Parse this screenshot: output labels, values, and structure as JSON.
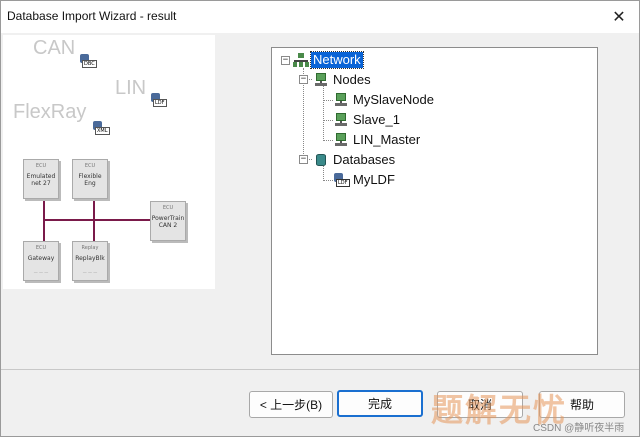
{
  "window": {
    "title": "Database Import Wizard - result",
    "close_label": "✕"
  },
  "illustration": {
    "bus_labels": [
      "CAN",
      "LIN",
      "FlexRay"
    ],
    "db_tags": [
      "DBC",
      "LDF",
      "XML"
    ],
    "ecus": [
      {
        "top": "ECU",
        "name": "Emulated\nnet 27",
        "foot": ""
      },
      {
        "top": "ECU",
        "name": "Flexible\nEng",
        "foot": ""
      },
      {
        "top": "ECU",
        "name": "PowerTrain\nCAN 2",
        "foot": ""
      },
      {
        "top": "ECU",
        "name": "Gateway",
        "foot": "— — —"
      },
      {
        "top": "Replay",
        "name": "ReplayBlk",
        "foot": "— — —"
      }
    ]
  },
  "tree": {
    "root": {
      "label": "Network",
      "expander": "−"
    },
    "nodes_folder": {
      "label": "Nodes",
      "expander": "−"
    },
    "nodes": [
      "MySlaveNode",
      "Slave_1",
      "LIN_Master"
    ],
    "databases_folder": {
      "label": "Databases",
      "expander": "−"
    },
    "databases": [
      "MyLDF"
    ],
    "ldf_tag": "LDF"
  },
  "buttons": {
    "back": "< 上一步(B)",
    "finish": "完成",
    "cancel": "取消",
    "help": "帮助"
  },
  "watermark": {
    "text": "题解无忧",
    "csdn": "CSDN @静听夜半雨"
  }
}
